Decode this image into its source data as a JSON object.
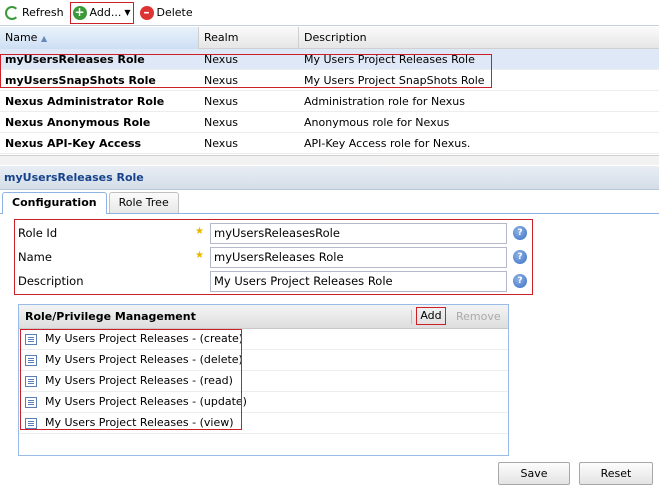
{
  "toolbar": {
    "refresh": "Refresh",
    "add": "Add...",
    "delete": "Delete"
  },
  "grid": {
    "columns": [
      "Name",
      "Realm",
      "Description"
    ],
    "rows": [
      {
        "name": "myUsersReleases Role",
        "realm": "Nexus",
        "description": "My Users Project Releases Role"
      },
      {
        "name": "myUsersSnapShots Role",
        "realm": "Nexus",
        "description": "My Users Project SnapShots Role"
      },
      {
        "name": "Nexus Administrator Role",
        "realm": "Nexus",
        "description": "Administration role for Nexus"
      },
      {
        "name": "Nexus Anonymous Role",
        "realm": "Nexus",
        "description": "Anonymous role for Nexus"
      },
      {
        "name": "Nexus API-Key Access",
        "realm": "Nexus",
        "description": "API-Key Access role for Nexus."
      }
    ]
  },
  "panel": {
    "title": "myUsersReleases Role",
    "tabs": [
      "Configuration",
      "Role Tree"
    ]
  },
  "form": {
    "role_id_label": "Role Id",
    "role_id": "myUsersReleasesRole",
    "name_label": "Name",
    "name": "myUsersReleases Role",
    "description_label": "Description",
    "description": "My Users Project Releases Role",
    "help": "?"
  },
  "privileges": {
    "title": "Role/Privilege Management",
    "add": "Add",
    "remove": "Remove",
    "items": [
      "My Users Project Releases - (create)",
      "My Users Project Releases - (delete)",
      "My Users Project Releases - (read)",
      "My Users Project Releases - (update)",
      "My Users Project Releases - (view)"
    ]
  },
  "buttons": {
    "save": "Save",
    "reset": "Reset"
  }
}
